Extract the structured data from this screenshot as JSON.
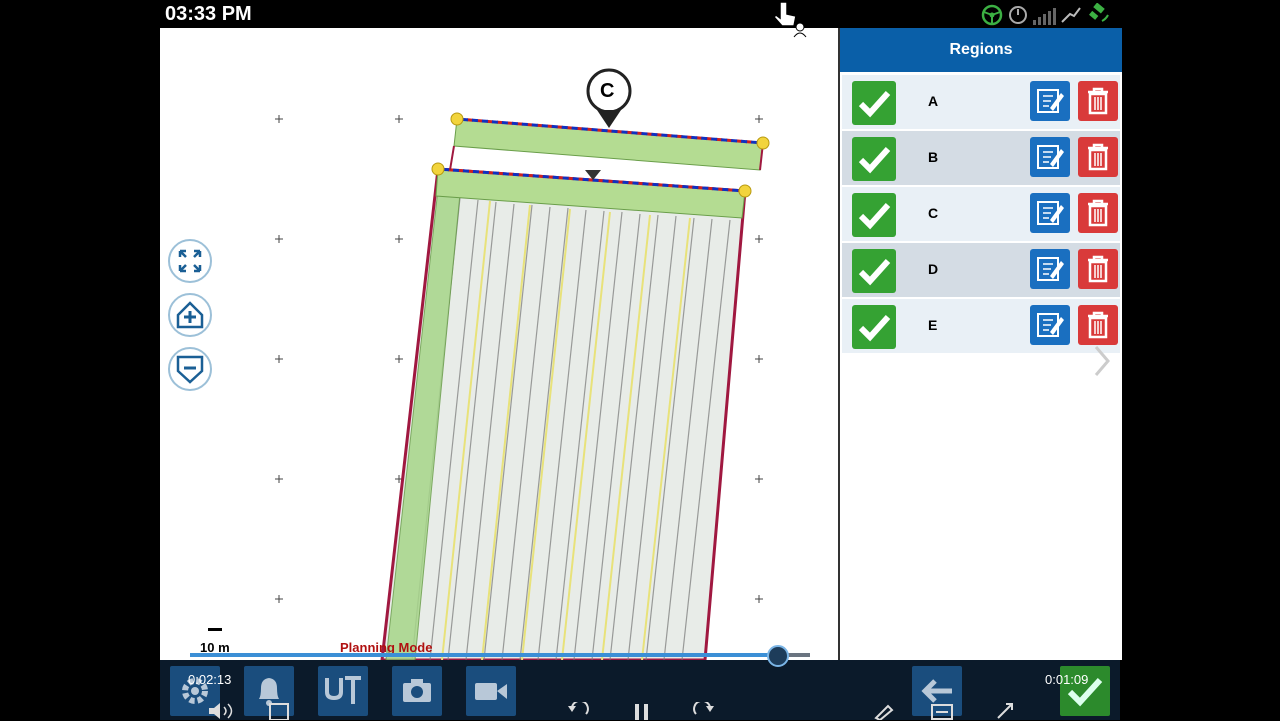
{
  "status_bar": {
    "time": "03:33 PM",
    "icons": [
      "steering-wheel-icon",
      "gauge-icon",
      "signal-bars-icon",
      "antenna-icon",
      "satellite-icon"
    ]
  },
  "map": {
    "marker_label": "C",
    "scale_label": "10 m",
    "mode_label": "Planning Mode",
    "controls": [
      "zoom-extents-icon",
      "home-plus-icon",
      "home-minus-icon"
    ]
  },
  "regions_panel": {
    "title": "Regions",
    "items": [
      {
        "name": "A"
      },
      {
        "name": "B"
      },
      {
        "name": "C"
      },
      {
        "name": "D"
      },
      {
        "name": "E"
      }
    ]
  },
  "player": {
    "elapsed": "0:02:13",
    "remaining": "0:01:09",
    "progress": 0.946
  },
  "toolbar": {
    "buttons": [
      "settings-icon",
      "bell-icon",
      "ut-icon",
      "camera-icon",
      "video-icon",
      "back-arrow-icon",
      "confirm-check-icon"
    ]
  },
  "colors": {
    "panel_header": "#0a5fa8",
    "check_green": "#35a233",
    "edit_blue": "#1a6fc0",
    "delete_red": "#d93a3a",
    "mode_red": "#b01010"
  }
}
